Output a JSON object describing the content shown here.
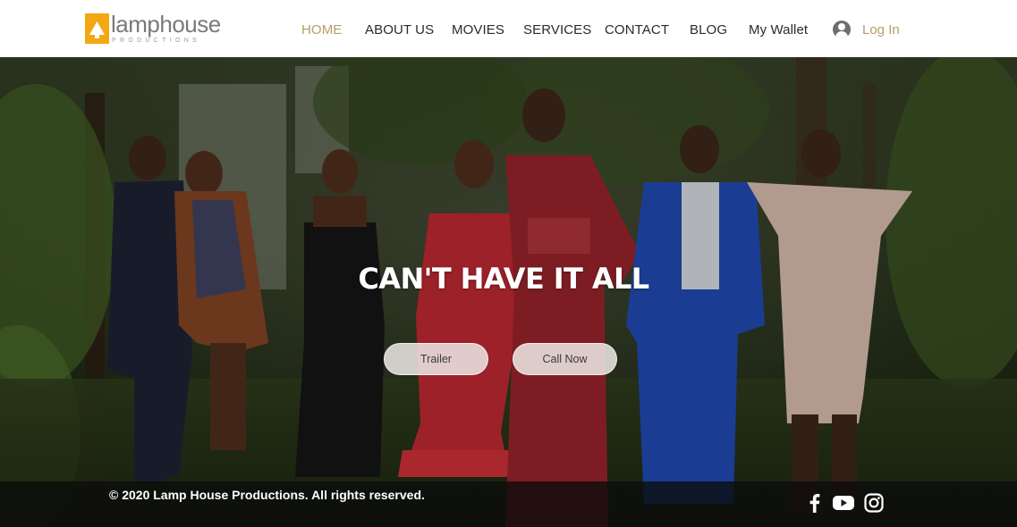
{
  "brand": {
    "name": "lamphouse",
    "tagline": "PRODUCTIONS",
    "color": "#f3a712"
  },
  "nav": {
    "items": [
      {
        "label": "HOME",
        "active": true
      },
      {
        "label": "ABOUT US",
        "active": false
      },
      {
        "label": "MOVIES",
        "active": false
      },
      {
        "label": "SERVICES",
        "active": false
      },
      {
        "label": "CONTACT",
        "active": false
      },
      {
        "label": "BLOG",
        "active": false
      },
      {
        "label": "My Wallet",
        "active": false
      }
    ],
    "active_color": "#b79d67"
  },
  "login": {
    "label": "Log In",
    "icon": "user-avatar-icon"
  },
  "hero": {
    "title": "CAN'T HAVE IT ALL",
    "buttons": {
      "trailer": "Trailer",
      "call_now": "Call Now"
    }
  },
  "footer": {
    "copyright": "© 2020 Lamp House Productions. All rights reserved.",
    "social": [
      "facebook-icon",
      "youtube-icon",
      "instagram-icon"
    ]
  }
}
